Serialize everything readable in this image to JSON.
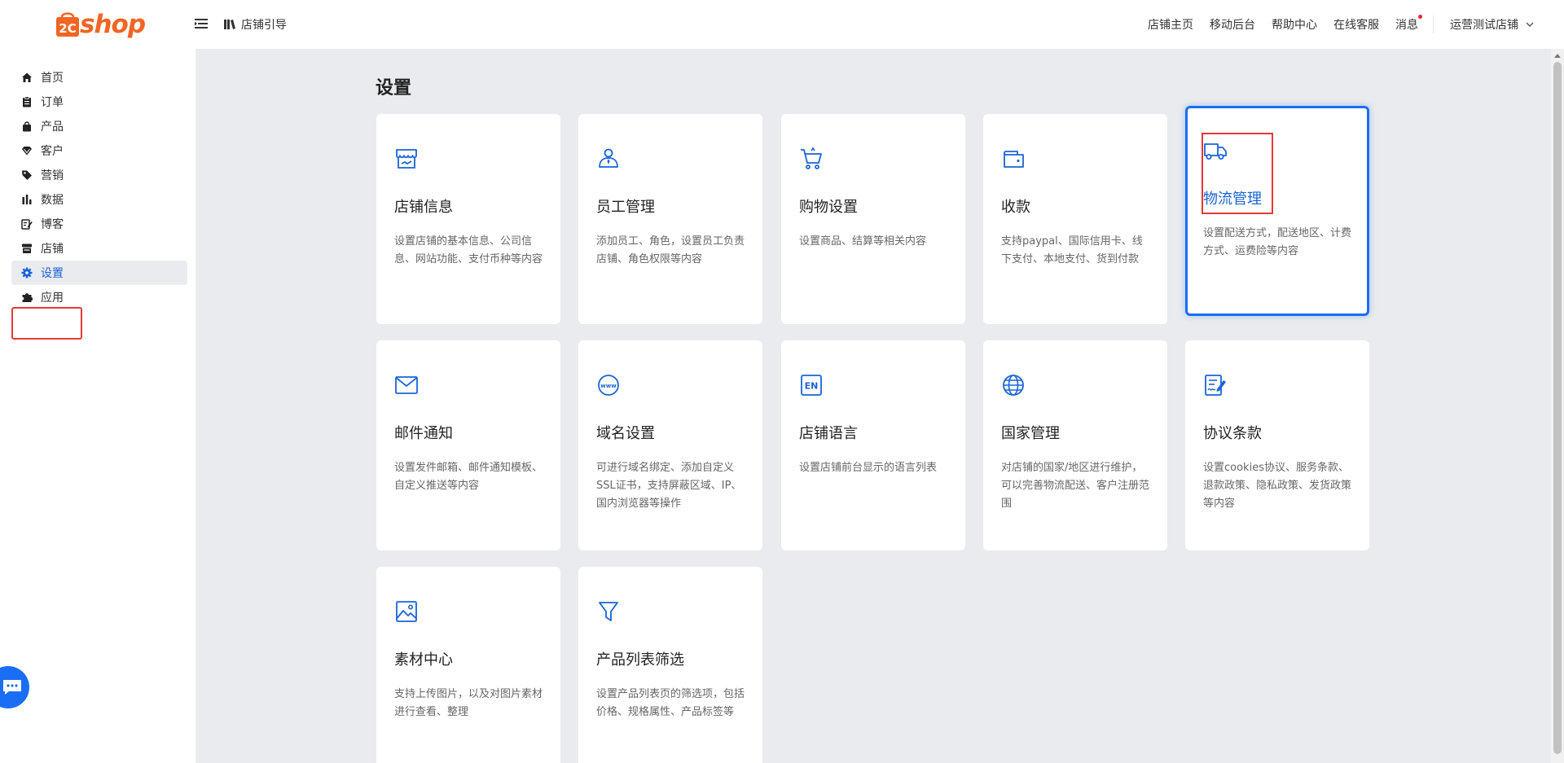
{
  "header": {
    "logo_text": "shop",
    "logo_mark": "2C",
    "guide_label": "店铺引导",
    "nav": [
      "店铺主页",
      "移动后台",
      "帮助中心",
      "在线客服",
      "消息"
    ],
    "store_name": "运营测试店铺"
  },
  "sidebar": {
    "items": [
      {
        "label": "首页",
        "icon": "home-icon"
      },
      {
        "label": "订单",
        "icon": "clipboard-icon"
      },
      {
        "label": "产品",
        "icon": "bag-icon"
      },
      {
        "label": "客户",
        "icon": "diamond-icon"
      },
      {
        "label": "营销",
        "icon": "tag-icon"
      },
      {
        "label": "数据",
        "icon": "bar-chart-icon"
      },
      {
        "label": "博客",
        "icon": "edit-icon"
      },
      {
        "label": "店铺",
        "icon": "store-icon"
      },
      {
        "label": "设置",
        "icon": "gear-icon",
        "active": true
      },
      {
        "label": "应用",
        "icon": "puzzle-icon"
      }
    ]
  },
  "main": {
    "title": "设置",
    "cards": [
      {
        "title": "店铺信息",
        "desc": "设置店铺的基本信息、公司信息、网站功能、支付币种等内容",
        "icon": "storefront-icon"
      },
      {
        "title": "员工管理",
        "desc": "添加员工、角色，设置员工负责店铺、角色权限等内容",
        "icon": "staff-icon"
      },
      {
        "title": "购物设置",
        "desc": "设置商品、结算等相关内容",
        "icon": "cart-icon"
      },
      {
        "title": "收款",
        "desc": "支持paypal、国际信用卡、线下支付、本地支付、货到付款",
        "icon": "wallet-icon"
      },
      {
        "title": "物流管理",
        "desc": "设置配送方式，配送地区、计费方式、运费险等内容",
        "icon": "truck-icon",
        "active": true
      },
      {
        "title": "邮件通知",
        "desc": "设置发件邮箱、邮件通知模板、自定义推送等内容",
        "icon": "mail-icon"
      },
      {
        "title": "域名设置",
        "desc": "可进行域名绑定、添加自定义SSL证书，支持屏蔽区域、IP、国内浏览器等操作",
        "icon": "www-icon"
      },
      {
        "title": "店铺语言",
        "desc": "设置店铺前台显示的语言列表",
        "icon": "language-en-icon"
      },
      {
        "title": "国家管理",
        "desc": "对店铺的国家/地区进行维护，可以完善物流配送、客户注册范围",
        "icon": "globe-icon"
      },
      {
        "title": "协议条款",
        "desc": "设置cookies协议、服务条款、退款政策、隐私政策、发货政策等内容",
        "icon": "document-sign-icon"
      },
      {
        "title": "素材中心",
        "desc": "支持上传图片，以及对图片素材进行查看、整理",
        "icon": "image-icon"
      },
      {
        "title": "产品列表筛选",
        "desc": "设置产品列表页的筛选项，包括价格、规格属性、产品标签等",
        "icon": "filter-icon"
      }
    ]
  },
  "colors": {
    "accent": "#1a6ef5",
    "brand": "#f26522",
    "highlight": "#e53935"
  }
}
